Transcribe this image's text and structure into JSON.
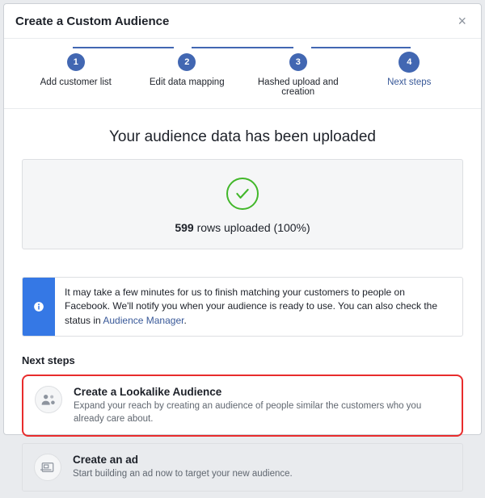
{
  "modal": {
    "title": "Create a Custom Audience",
    "close": "×"
  },
  "steps": [
    {
      "num": "1",
      "label": "Add customer list"
    },
    {
      "num": "2",
      "label": "Edit data mapping"
    },
    {
      "num": "3",
      "label": "Hashed upload and creation"
    },
    {
      "num": "4",
      "label": "Next steps"
    }
  ],
  "upload": {
    "title": "Your audience data has been uploaded",
    "rows_count": "599",
    "rows_label": " rows uploaded (100%)"
  },
  "notice": {
    "text_before": "It may take a few minutes for us to finish matching your customers to people on Facebook. We'll notify you when your audience is ready to use. You can also check the status in ",
    "link": "Audience Manager",
    "text_after": "."
  },
  "next": {
    "heading": "Next steps",
    "options": [
      {
        "title": "Create a Lookalike Audience",
        "desc": "Expand your reach by creating an audience of people similar the customers who you already care about."
      },
      {
        "title": "Create an ad",
        "desc": "Start building an ad now to target your new audience."
      }
    ]
  }
}
